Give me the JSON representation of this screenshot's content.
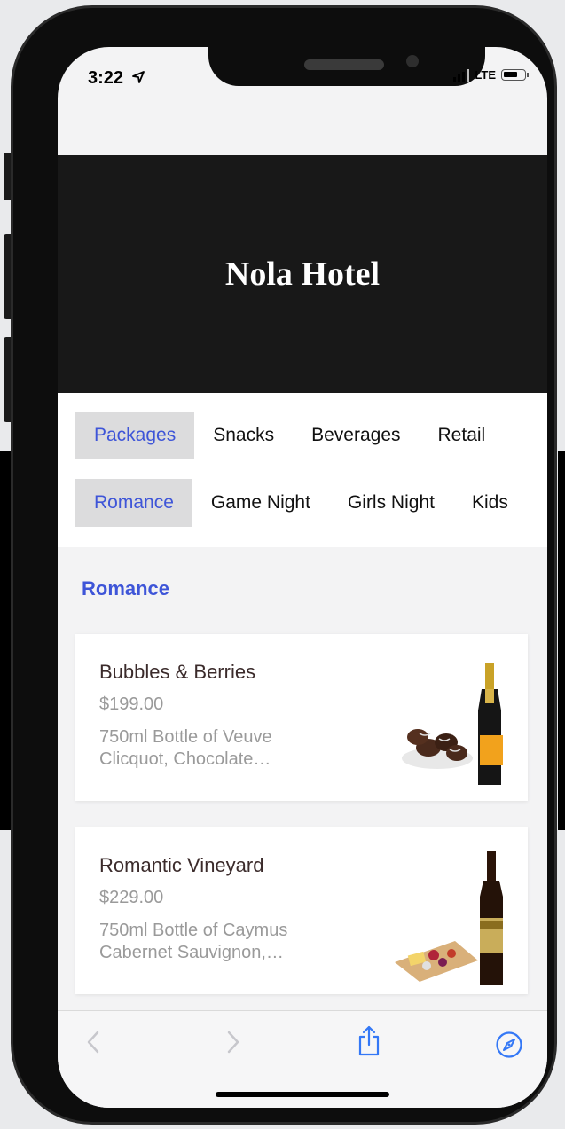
{
  "status": {
    "time": "3:22",
    "network": "LTE"
  },
  "hero": {
    "title": "Nola Hotel"
  },
  "categories": [
    "Packages",
    "Snacks",
    "Beverages",
    "Retail"
  ],
  "subcategories": [
    "Romance",
    "Game Night",
    "Girls Night",
    "Kids"
  ],
  "section": {
    "title": "Romance"
  },
  "items": [
    {
      "name": "Bubbles & Berries",
      "price": "$199.00",
      "desc": "750ml Bottle of Veuve Clicquot, Chocolate…"
    },
    {
      "name": "Romantic Vineyard",
      "price": "$229.00",
      "desc": "750ml Bottle of Caymus Cabernet Sauvignon,…"
    }
  ],
  "toolbar": {
    "icons": [
      "back-icon",
      "forward-icon",
      "share-icon",
      "compass-icon"
    ]
  },
  "colors": {
    "accent": "#3e55d8",
    "hero_bg": "#181818"
  }
}
